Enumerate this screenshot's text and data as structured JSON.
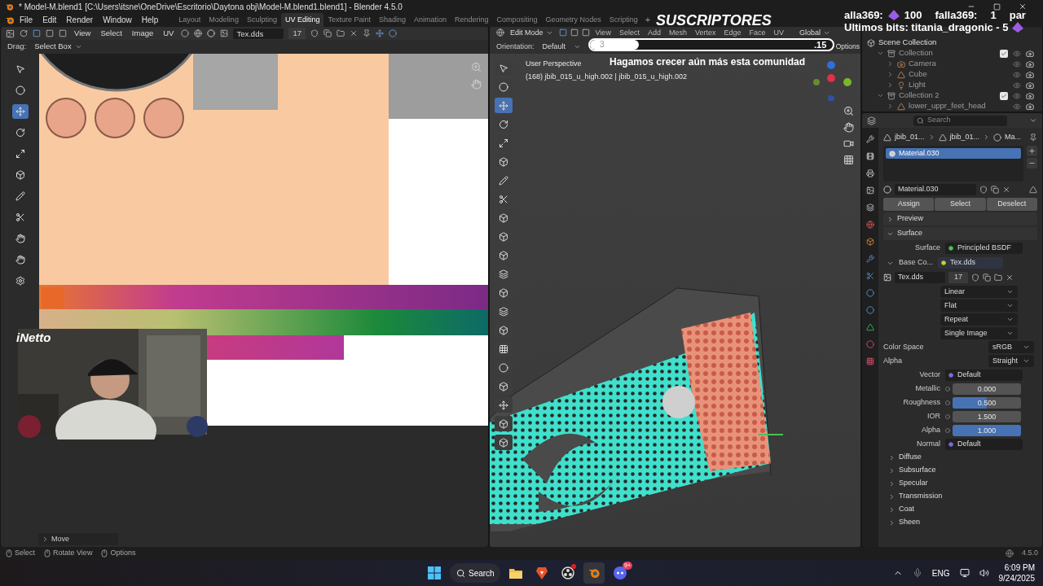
{
  "title_bar": {
    "title": "* Model-M.blend1 [C:\\Users\\itsne\\OneDrive\\Escritorio\\Daytona obj\\Model-M.blend1.blend1] - Blender 4.5.0"
  },
  "menus": [
    "File",
    "Edit",
    "Render",
    "Window",
    "Help"
  ],
  "workspaces": [
    {
      "label": "Layout",
      "selected": false
    },
    {
      "label": "Modeling",
      "selected": false
    },
    {
      "label": "Sculpting",
      "selected": false
    },
    {
      "label": "UV Editing",
      "selected": true
    },
    {
      "label": "Texture Paint",
      "selected": false
    },
    {
      "label": "Shading",
      "selected": false
    },
    {
      "label": "Animation",
      "selected": false
    },
    {
      "label": "Rendering",
      "selected": false
    },
    {
      "label": "Compositing",
      "selected": false
    },
    {
      "label": "Geometry Nodes",
      "selected": false
    },
    {
      "label": "Scripting",
      "selected": false
    }
  ],
  "add_workspace": "+",
  "uv_editor": {
    "menus": [
      "View",
      "Select",
      "Image",
      "UV"
    ],
    "image": "Tex.dds",
    "users": "17",
    "drag_label": "Drag:",
    "drag_mode": "Select Box",
    "last_operator": "Move"
  },
  "viewport": {
    "mode": "Edit Mode",
    "menus": [
      "View",
      "Select",
      "Add",
      "Mesh",
      "Vertex",
      "Edge",
      "Face",
      "UV"
    ],
    "transform": "Global",
    "orientation_label": "Orientation:",
    "orientation": "Default",
    "options": "Options",
    "view_name": "User Perspective",
    "object_info": "(168) jbib_015_u_high.002 | jbib_015_u_high.002"
  },
  "outliner": {
    "items": [
      {
        "label": "Scene Collection",
        "kind": "scene",
        "children": [
          {
            "label": "Collection",
            "kind": "collection",
            "checked": true,
            "expanded": true,
            "children": [
              {
                "label": "Camera",
                "kind": "camera",
                "expanded": false
              },
              {
                "label": "Cube",
                "kind": "mesh",
                "expanded": false
              },
              {
                "label": "Light",
                "kind": "light",
                "expanded": false
              }
            ]
          },
          {
            "label": "Collection 2",
            "kind": "collection",
            "checked": true,
            "expanded": true,
            "children": [
              {
                "label": "lower_uppr_feet_head",
                "kind": "mesh",
                "expanded": false
              }
            ]
          }
        ]
      }
    ]
  },
  "properties": {
    "search_placeholder": "Search",
    "breadcrumb": [
      "jbib_01...",
      "jbib_01...",
      "Ma..."
    ],
    "slots": [
      {
        "name": "Material.030",
        "selected": true
      }
    ],
    "material": "Material.030",
    "actions": [
      "Assign",
      "Select",
      "Deselect"
    ],
    "panels": [
      {
        "label": "Preview",
        "expanded": false
      },
      {
        "label": "Surface",
        "expanded": true
      }
    ],
    "surface_label": "Surface",
    "shader": "Principled BSDF",
    "base_color_label": "Base Co...",
    "base_color": "Tex.dds",
    "image": "Tex.dds",
    "image_users": "17",
    "image_options": [
      "Linear",
      "Flat",
      "Repeat",
      "Single Image"
    ],
    "settings": [
      {
        "label": "Color Space",
        "value": "sRGB"
      },
      {
        "label": "Alpha",
        "value": "Straight"
      }
    ],
    "inputs": [
      {
        "kind": "link",
        "label": "Vector",
        "value": "Default"
      },
      {
        "kind": "number",
        "label": "Metallic",
        "value": "0.000"
      },
      {
        "kind": "slider",
        "label": "Roughness",
        "value": "0.500",
        "level": 0.5
      },
      {
        "kind": "number",
        "label": "IOR",
        "value": "1.500"
      },
      {
        "kind": "slider",
        "label": "Alpha",
        "value": "1.000",
        "level": 1
      },
      {
        "kind": "link",
        "label": "Normal",
        "value": "Default"
      }
    ],
    "subpanels": [
      {
        "label": "Diffuse",
        "expanded": false
      },
      {
        "label": "Subsurface",
        "expanded": false
      },
      {
        "label": "Specular",
        "expanded": false
      },
      {
        "label": "Transmission",
        "expanded": false
      },
      {
        "label": "Coat",
        "expanded": false
      },
      {
        "label": "Sheen",
        "expanded": false
      }
    ]
  },
  "status_bar": {
    "hints": [
      "Select",
      "Rotate View",
      "Options"
    ],
    "version": "4.5.0"
  },
  "taskbar": {
    "search": "Search",
    "apps": [
      {
        "kind": "files",
        "selected": false,
        "alert": false
      },
      {
        "kind": "brave",
        "selected": false,
        "alert": false
      },
      {
        "kind": "obs",
        "selected": false,
        "alert": true
      },
      {
        "kind": "blender",
        "selected": true,
        "alert": false
      },
      {
        "kind": "discord",
        "selected": false,
        "alert": false,
        "badge": "9+"
      }
    ],
    "language": "ENG",
    "time": "6:09 PM",
    "date": "9/24/2025"
  },
  "stream_overlay": {
    "title": "SUSCRIPTORES",
    "goal_count": "3",
    "goal_target": ".15",
    "level": 0.2,
    "message": "Hagamos crecer aún más esta comunidad",
    "ticker": [
      "alla369:",
      "100",
      "falla369:",
      "1",
      "par"
    ],
    "bits": "Ultimos bits: titania_dragonic - 5",
    "webcam_label": "iNetto"
  }
}
